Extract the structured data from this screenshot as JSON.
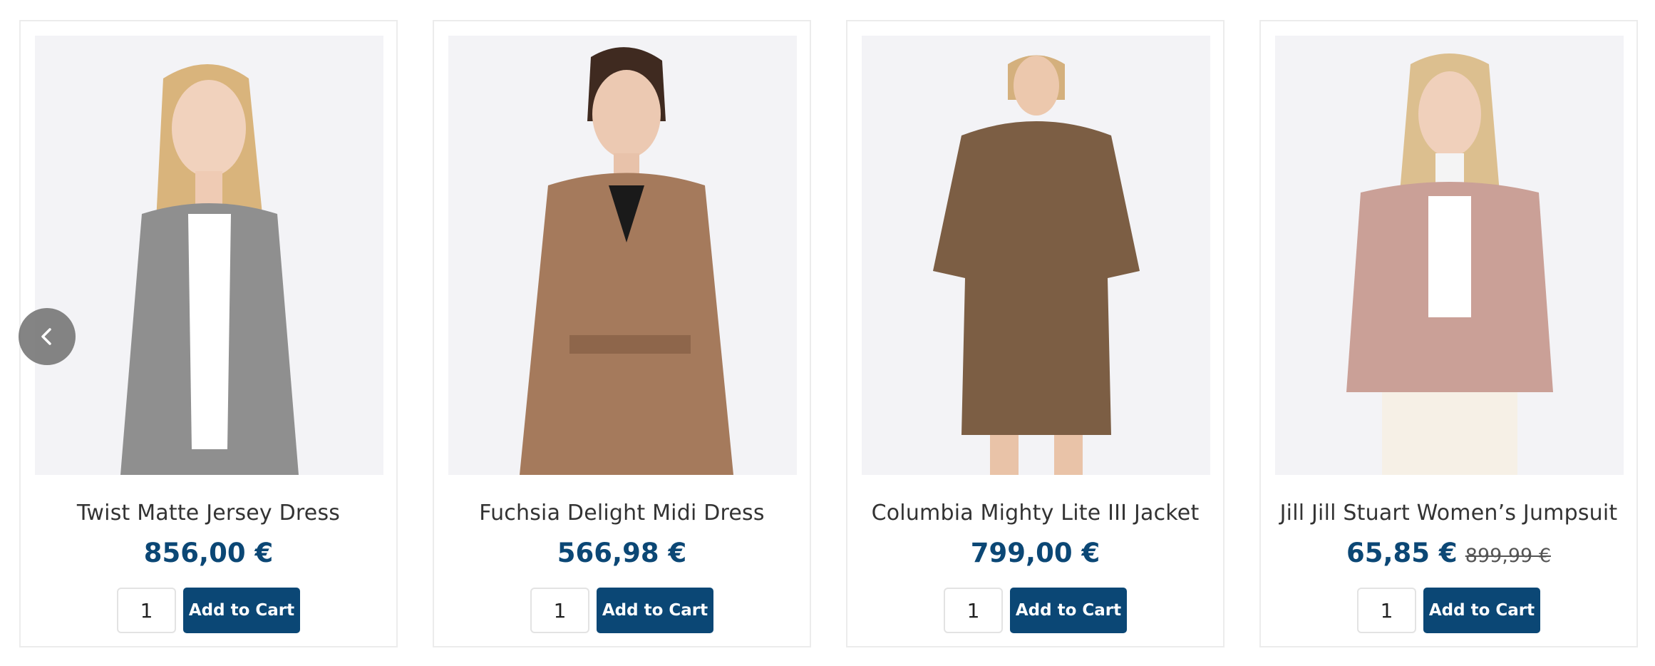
{
  "products": [
    {
      "name": "Twist Matte Jersey Dress",
      "price": "856,00 €",
      "old_price": "",
      "quantity": "1",
      "add_label": "Add to Cart",
      "garment_color": "#8f8f8f"
    },
    {
      "name": "Fuchsia Delight Midi Dress",
      "price": "566,98 €",
      "old_price": "",
      "quantity": "1",
      "add_label": "Add to Cart",
      "garment_color": "#a57a5c"
    },
    {
      "name": "Columbia Mighty Lite III Jacket",
      "price": "799,00 €",
      "old_price": "",
      "quantity": "1",
      "add_label": "Add to Cart",
      "garment_color": "#7c5e44"
    },
    {
      "name": "Jill Jill Stuart Women’s Jumpsuit",
      "price": "65,85 €",
      "old_price": "899,99 €",
      "quantity": "1",
      "add_label": "Add to Cart",
      "garment_color": "#caa097"
    }
  ],
  "colors": {
    "accent": "#0b4775",
    "thumb_bg": "#f3f3f6",
    "border": "#ececec"
  },
  "icons": {
    "prev": "chevron-left-icon"
  }
}
